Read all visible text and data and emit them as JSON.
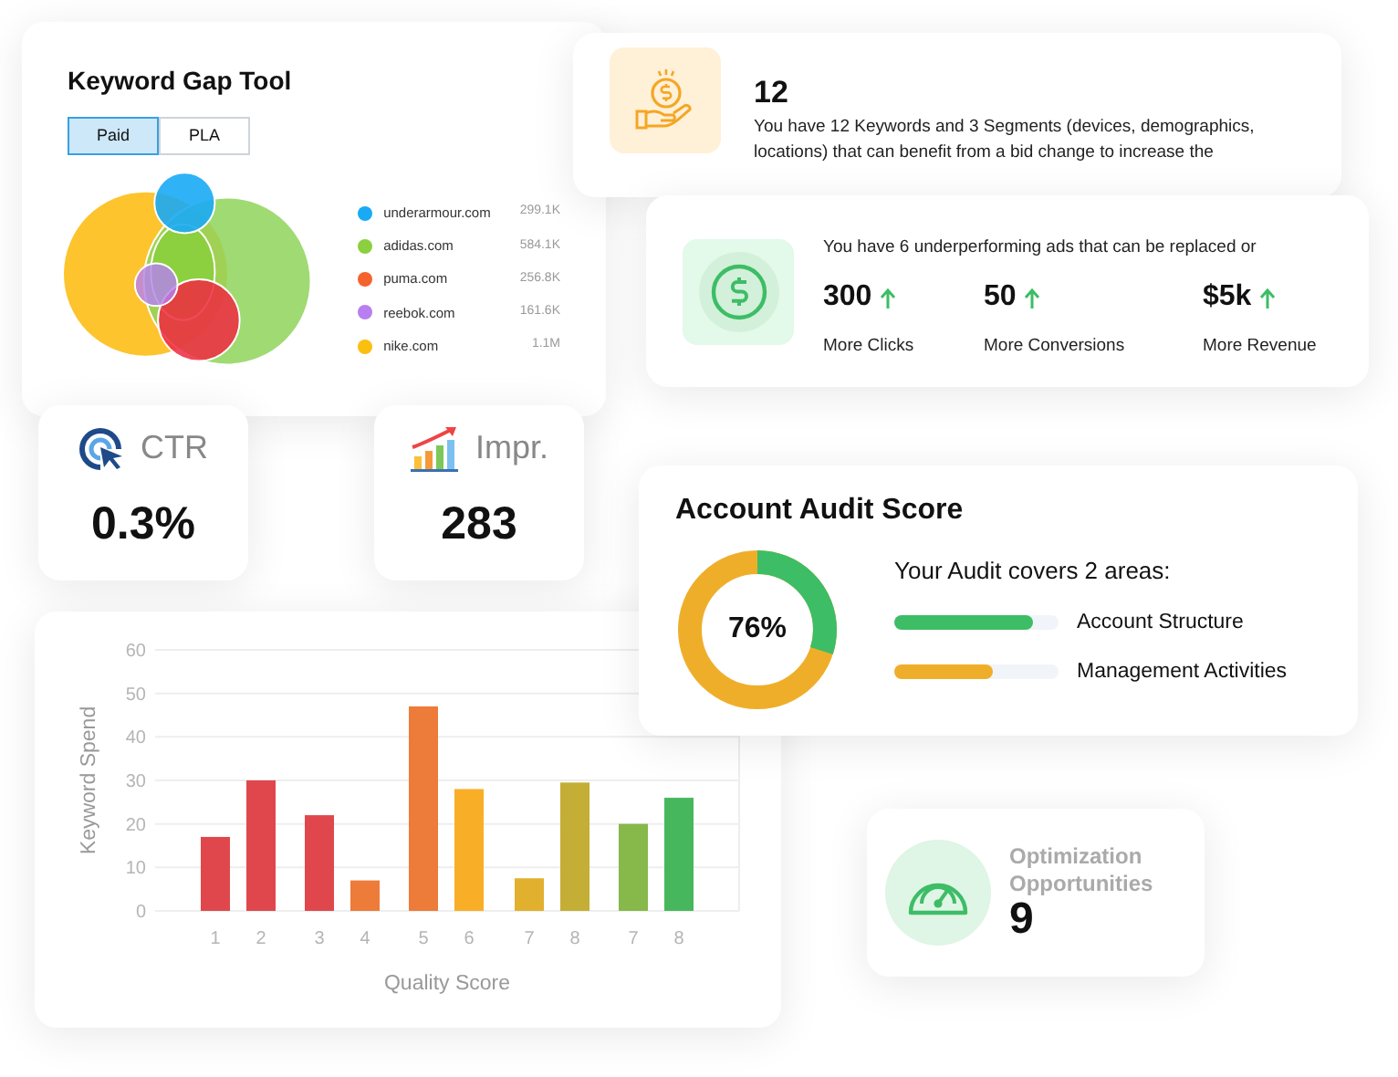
{
  "keyword_gap": {
    "title": "Keyword Gap Tool",
    "tabs": [
      {
        "label": "Paid",
        "selected": true
      },
      {
        "label": "PLA",
        "selected": false
      }
    ],
    "legend": [
      {
        "domain": "underarmour.com",
        "value": "299.1K",
        "color": "#1aaaf5"
      },
      {
        "domain": "adidas.com",
        "value": "584.1K",
        "color": "#8ccf3f"
      },
      {
        "domain": "puma.com",
        "value": "256.8K",
        "color": "#f5622e"
      },
      {
        "domain": "reebok.com",
        "value": "161.6K",
        "color": "#b77ff0"
      },
      {
        "domain": "nike.com",
        "value": "1.1M",
        "color": "#fbbf0f"
      }
    ]
  },
  "bid_card": {
    "count": "12",
    "text": "You have 12 Keywords and 3 Segments (devices, demographics, locations) that can benefit from a bid change to increase the"
  },
  "ads_card": {
    "text": "You have 6 underperforming ads that can be replaced or",
    "stats": [
      {
        "value": "300",
        "label": "More Clicks"
      },
      {
        "value": "50",
        "label": "More Conversions"
      },
      {
        "value": "$5k",
        "label": "More Revenue"
      }
    ]
  },
  "metrics": [
    {
      "kind": "ctr",
      "label": "CTR",
      "value": "0.3%"
    },
    {
      "kind": "impressions",
      "label": "Impr.",
      "value": "283"
    }
  ],
  "spend_chart": {
    "bars": [
      {
        "color": "#e0474c"
      },
      {
        "color": "#e0474c"
      },
      {
        "color": "#e0474c"
      },
      {
        "color": "#ed7b39"
      },
      {
        "color": "#ed7b39"
      },
      {
        "color": "#f9ae28"
      },
      {
        "color": "#e2b02f"
      },
      {
        "color": "#c4ae36"
      },
      {
        "color": "#86b84a"
      },
      {
        "color": "#47b75d"
      }
    ],
    "chart_data": {
      "type": "bar",
      "grid": true,
      "xlabel": "Quality Score",
      "ylabel": "Keyword Spend",
      "categories": [
        "1",
        "2",
        "3",
        "4",
        "5",
        "6",
        "7",
        "8",
        "7",
        "8"
      ],
      "values": [
        17,
        30,
        22,
        7,
        47,
        28,
        7.5,
        29.5,
        20,
        26
      ],
      "ylim": [
        0,
        60
      ],
      "yticks": [
        0,
        10,
        20,
        30,
        40,
        50,
        60
      ]
    }
  },
  "audit": {
    "title": "Account Audit Score",
    "score": "76%",
    "level": 0.3,
    "subtitle": "Your Audit covers 2 areas:",
    "areas": [
      {
        "label": "Account Structure",
        "level": 0.84,
        "color": "#3dbd66"
      },
      {
        "label": "Management Activities",
        "level": 0.6,
        "color": "#efae2a"
      }
    ]
  },
  "optimization": {
    "label": "Optimization Opportunities",
    "value": "9"
  }
}
